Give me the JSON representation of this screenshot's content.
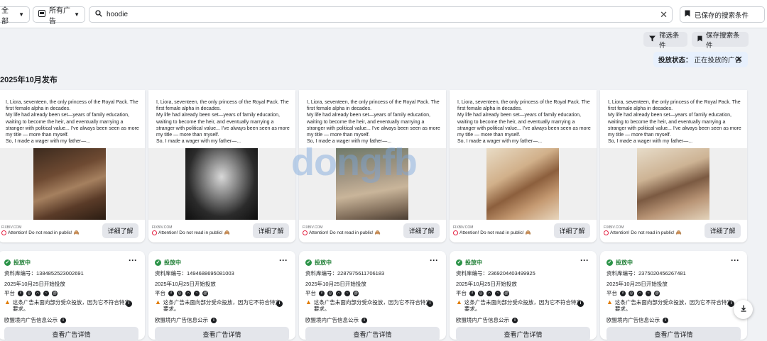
{
  "toolbar": {
    "category_label": "全部",
    "adtype_label": "所有广告",
    "search_value": "hoodie",
    "saved_searches_label": "已保存的搜索条件"
  },
  "filters": {
    "filter_label": "筛选条件",
    "save_search_label": "保存搜索条件",
    "status_key": "投放状态：",
    "status_value": "正在投放的广告"
  },
  "section_heading": "2025年10月发布",
  "ad_text": "I, Liora, seventeen, the only princess of the Royal Pack. The first female alpha in decades.\nMy life had already been set—years of family education, waiting to become the heir, and eventually marrying a stranger with political value... I've always been seen as more my title — more than myself.\nSo, I made a wager with my father—...",
  "ad_domain": "FIXBIV.COM",
  "ad_caption": "Attention! Do not read in public!",
  "ad_caption_emoji": "🙈",
  "learn_more_label": "详细了解",
  "active_label": "投放中",
  "started_label": "2025年10月25日开始投放",
  "platforms_label": "平台",
  "warning_text": "这条广告未面向部分受众投放，因为它不符合特定要求。",
  "eu_label": "欧盟境内广告信息公示",
  "detail_button_label": "查看广告详情",
  "library_ids": [
    "资料库编号：1384852523002691",
    "资料库编号：1494688695081003",
    "资料库编号：2287975611706183",
    "资料库编号：2369204403499925",
    "资料库编号：2375020456267481"
  ],
  "watermark": "dongfb",
  "colors": {
    "active_green": "#2b9348",
    "status_bg": "#e7f0fd",
    "button_gray": "#e4e6eb",
    "page_bg": "#f0f2f5"
  }
}
